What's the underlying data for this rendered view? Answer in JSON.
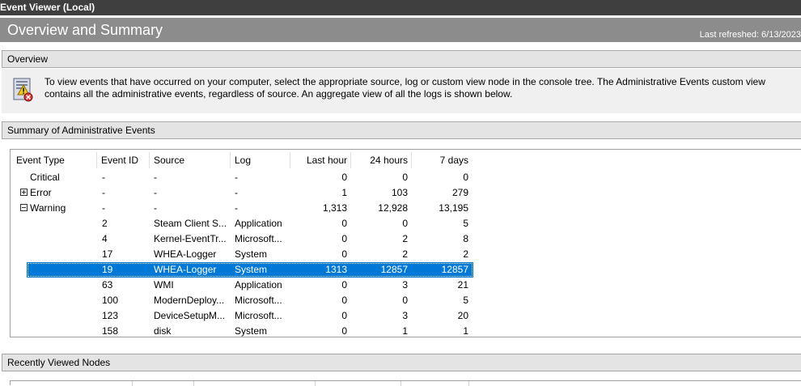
{
  "window": {
    "title": "Event Viewer (Local)"
  },
  "banner": {
    "heading": "Overview and Summary",
    "refreshed": "Last refreshed: 6/13/2023"
  },
  "overview": {
    "heading": "Overview",
    "text": "To view events that have occurred on your computer, select the appropriate source, log or custom view node in the console tree. The Administrative Events custom view contains all the administrative events, regardless of source. An aggregate view of all the logs is shown below.",
    "icon": "event-log-info-icon"
  },
  "summary": {
    "heading": "Summary of Administrative Events",
    "columns": [
      "Event Type",
      "Event ID",
      "Source",
      "Log",
      "Last hour",
      "24 hours",
      "7 days"
    ],
    "rows": [
      {
        "type": "Critical",
        "id": "-",
        "source": "-",
        "log": "-",
        "hour": "0",
        "day": "0",
        "week": "0",
        "expander": ""
      },
      {
        "type": "Error",
        "id": "-",
        "source": "-",
        "log": "-",
        "hour": "1",
        "day": "103",
        "week": "279",
        "expander": "plus"
      },
      {
        "type": "Warning",
        "id": "-",
        "source": "-",
        "log": "-",
        "hour": "1,313",
        "day": "12,928",
        "week": "13,195",
        "expander": "minus"
      },
      {
        "type": "",
        "id": "2",
        "source": "Steam Client S...",
        "log": "Application",
        "hour": "0",
        "day": "0",
        "week": "5"
      },
      {
        "type": "",
        "id": "4",
        "source": "Kernel-EventTr...",
        "log": "Microsoft...",
        "hour": "0",
        "day": "2",
        "week": "8"
      },
      {
        "type": "",
        "id": "17",
        "source": "WHEA-Logger",
        "log": "System",
        "hour": "0",
        "day": "2",
        "week": "2"
      },
      {
        "type": "",
        "id": "19",
        "source": "WHEA-Logger",
        "log": "System",
        "hour": "1313",
        "day": "12857",
        "week": "12857",
        "selected": true
      },
      {
        "type": "",
        "id": "63",
        "source": "WMI",
        "log": "Application",
        "hour": "0",
        "day": "3",
        "week": "21"
      },
      {
        "type": "",
        "id": "100",
        "source": "ModernDeploy...",
        "log": "Microsoft...",
        "hour": "0",
        "day": "0",
        "week": "5"
      },
      {
        "type": "",
        "id": "123",
        "source": "DeviceSetupM...",
        "log": "Microsoft...",
        "hour": "0",
        "day": "3",
        "week": "20"
      },
      {
        "type": "",
        "id": "158",
        "source": "disk",
        "log": "System",
        "hour": "0",
        "day": "1",
        "week": "1"
      }
    ]
  },
  "recent": {
    "heading": "Recently Viewed Nodes"
  },
  "colors": {
    "selection": "#0078d7",
    "banner": "#8c8c8c",
    "titlebar": "#3f3f3f",
    "section": "#e4e4e4"
  }
}
